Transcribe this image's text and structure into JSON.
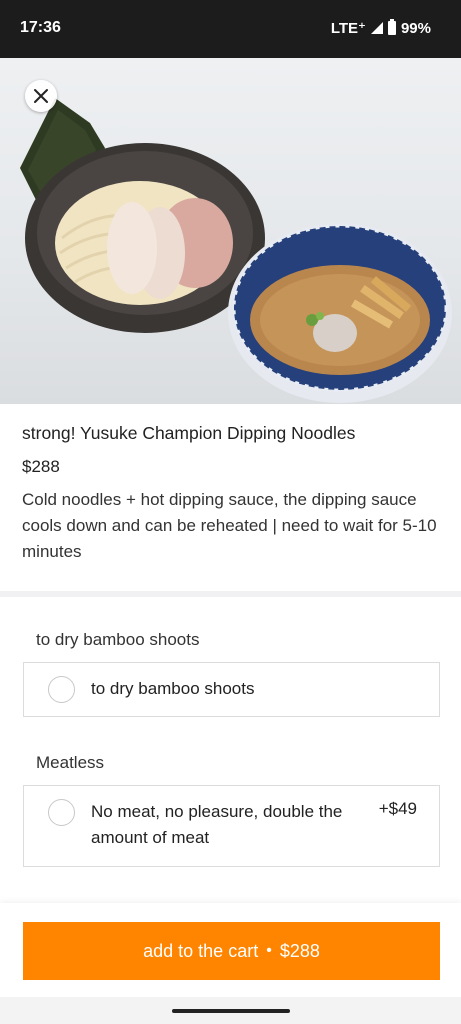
{
  "status_bar": {
    "time": "17:36",
    "network": "LTE⁺",
    "battery": "99%"
  },
  "product": {
    "title": "strong! Yusuke Champion Dipping Noodles",
    "price": "$288",
    "description": "Cold noodles + hot dipping sauce, the dipping sauce cools down and can be reheated | need to wait for 5-10 minutes"
  },
  "option_groups": [
    {
      "title": "to dry bamboo shoots",
      "options": [
        {
          "label": "to dry bamboo shoots",
          "price": "",
          "selected": false
        }
      ]
    },
    {
      "title": "Meatless",
      "options": [
        {
          "label": "No meat, no pleasure, double the amount of meat",
          "price": "+$49",
          "selected": false
        }
      ]
    }
  ],
  "cart_button": {
    "label": "add to the cart",
    "separator": "•",
    "price": "$288"
  },
  "colors": {
    "accent": "#ff8500",
    "status_bar": "#1c1c1c"
  },
  "icons": {
    "close": "close-icon",
    "signal": "signal-icon",
    "battery": "battery-icon"
  }
}
